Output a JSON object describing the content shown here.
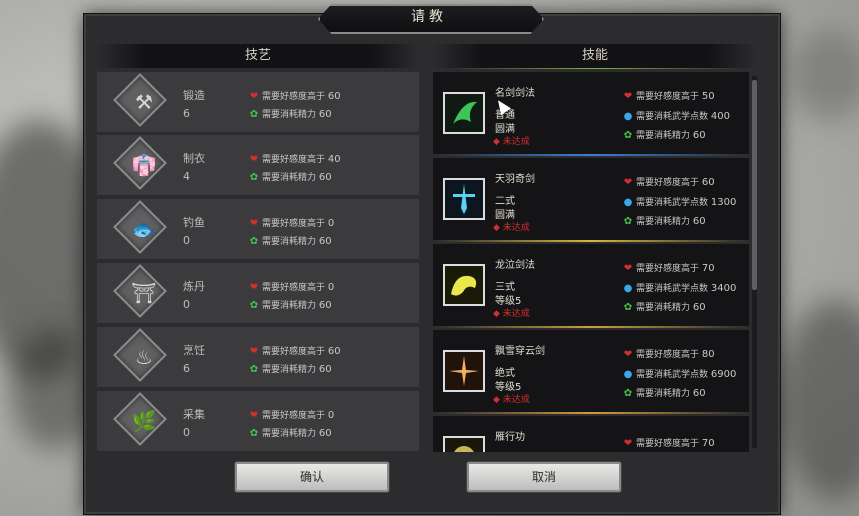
{
  "title": "请教",
  "left_header": "技艺",
  "right_header": "技能",
  "crafts": [
    {
      "name": "锻造",
      "level": "6",
      "glyph": "⚒",
      "req1": "需要好感度高于",
      "req1_val": "60",
      "req2": "需要消耗精力",
      "req2_val": "60"
    },
    {
      "name": "制衣",
      "level": "4",
      "glyph": "👘",
      "req1": "需要好感度高于",
      "req1_val": "40",
      "req2": "需要消耗精力",
      "req2_val": "60"
    },
    {
      "name": "钓鱼",
      "level": "0",
      "glyph": "🐟",
      "req1": "需要好感度高于",
      "req1_val": "0",
      "req2": "需要消耗精力",
      "req2_val": "60"
    },
    {
      "name": "炼丹",
      "level": "0",
      "glyph": "⛩",
      "req1": "需要好感度高于",
      "req1_val": "0",
      "req2": "需要消耗精力",
      "req2_val": "60"
    },
    {
      "name": "烹饪",
      "level": "6",
      "glyph": "♨",
      "req1": "需要好感度高于",
      "req1_val": "60",
      "req2": "需要消耗精力",
      "req2_val": "60"
    },
    {
      "name": "采集",
      "level": "0",
      "glyph": "🌿",
      "req1": "需要好感度高于",
      "req1_val": "0",
      "req2": "需要消耗精力",
      "req2_val": "60"
    }
  ],
  "skills": [
    {
      "name": "名剑剑法",
      "line1": "普通",
      "line2": "圆满",
      "status": "未达成",
      "icon_color": "#42d862",
      "sep_color": "#3b7fd6",
      "req1": "需要好感度高于",
      "req1_val": "50",
      "req2": "需要消耗武学点数",
      "req2_val": "400",
      "req3": "需要消耗精力",
      "req3_val": "60"
    },
    {
      "name": "天羽奇剑",
      "line1": "二式",
      "line2": "圆满",
      "status": "未达成",
      "icon_color": "#5ad0f2",
      "sep_color": "#d6b83b",
      "req1": "需要好感度高于",
      "req1_val": "60",
      "req2": "需要消耗武学点数",
      "req2_val": "1300",
      "req3": "需要消耗精力",
      "req3_val": "60"
    },
    {
      "name": "龙泣剑法",
      "line1": "三式",
      "line2": "等级5",
      "status": "未达成",
      "icon_color": "#e8e84a",
      "sep_color": "#c8a040",
      "req1": "需要好感度高于",
      "req1_val": "70",
      "req2": "需要消耗武学点数",
      "req2_val": "3400",
      "req3": "需要消耗精力",
      "req3_val": "60"
    },
    {
      "name": "飘雪穿云剑",
      "line1": "绝式",
      "line2": "等级5",
      "status": "未达成",
      "icon_color": "#f0b060",
      "sep_color": "#d69a3b",
      "req1": "需要好感度高于",
      "req1_val": "80",
      "req2": "需要消耗武学点数",
      "req2_val": "6900",
      "req3": "需要消耗精力",
      "req3_val": "60"
    },
    {
      "name": "雁行功",
      "line1": "",
      "line2": "",
      "status": "",
      "icon_color": "#f0e070",
      "sep_color": "#2b2b2d",
      "req1": "需要好感度高于",
      "req1_val": "70",
      "req2": "",
      "req2_val": "",
      "req3": "",
      "req3_val": ""
    }
  ],
  "buttons": {
    "ok": "确认",
    "cancel": "取消"
  }
}
